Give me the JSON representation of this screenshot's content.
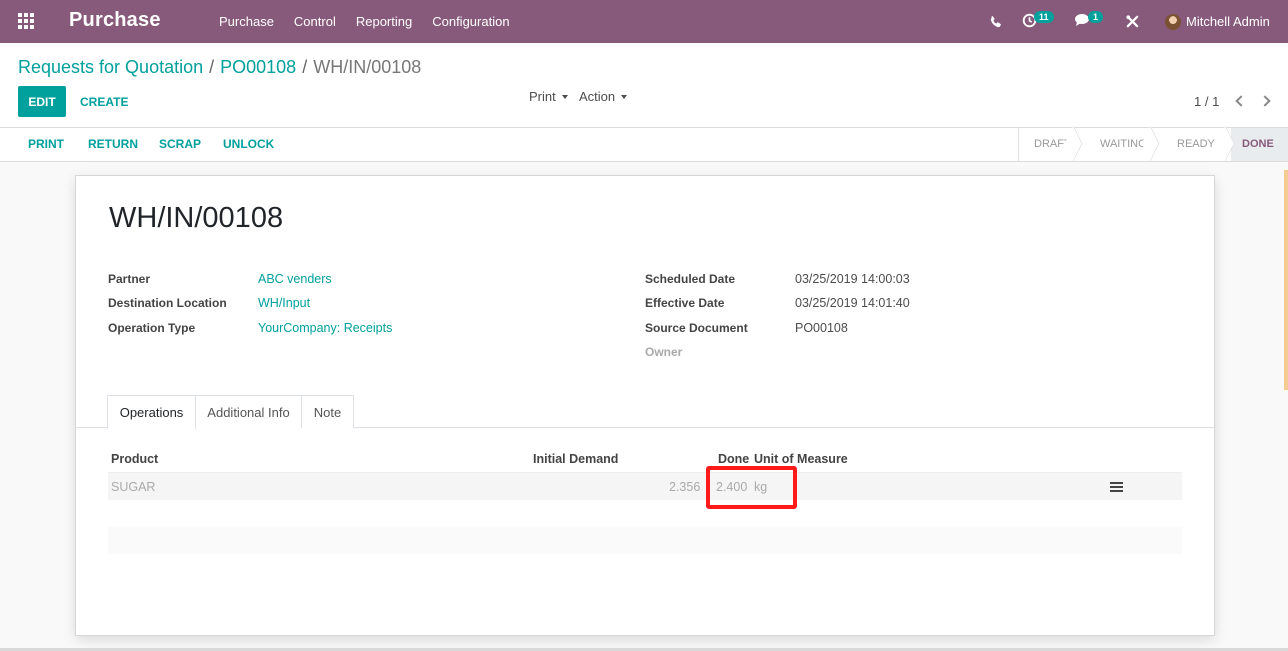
{
  "navbar": {
    "brand": "Purchase",
    "menu": [
      "Purchase",
      "Control",
      "Reporting",
      "Configuration"
    ],
    "activity_badge": "11",
    "messages_badge": "1",
    "user_name": "Mitchell Admin"
  },
  "breadcrumb": {
    "items": [
      "Requests for Quotation",
      "PO00108"
    ],
    "current": "WH/IN/00108"
  },
  "control": {
    "edit_label": "EDIT",
    "create_label": "CREATE",
    "print_label": "Print",
    "action_label": "Action",
    "pager": "1 / 1"
  },
  "header": {
    "buttons": [
      "PRINT",
      "RETURN",
      "SCRAP",
      "UNLOCK"
    ],
    "states": [
      "DRAFT",
      "WAITING",
      "READY",
      "DONE"
    ],
    "current_state": "DONE"
  },
  "record": {
    "title": "WH/IN/00108",
    "left_fields": [
      {
        "label": "Partner",
        "value": "ABC venders"
      },
      {
        "label": "Destination Location",
        "value": "WH/Input"
      },
      {
        "label": "Operation Type",
        "value": "YourCompany: Receipts"
      }
    ],
    "right_fields": [
      {
        "label": "Scheduled Date",
        "value": "03/25/2019 14:00:03"
      },
      {
        "label": "Effective Date",
        "value": "03/25/2019 14:01:40"
      },
      {
        "label": "Source Document",
        "value": "PO00108"
      },
      {
        "label": "Owner",
        "value": ""
      }
    ]
  },
  "tabs": [
    "Operations",
    "Additional Info",
    "Note"
  ],
  "operations": {
    "columns": [
      "Product",
      "Initial Demand",
      "Done",
      "Unit of Measure"
    ],
    "rows": [
      {
        "product": "SUGAR",
        "initial_demand": "2.356",
        "done": "2.400",
        "uom": "kg"
      }
    ]
  },
  "colors": {
    "brand": "#875a7b",
    "accent": "#00a09d",
    "highlight": "#ff1a1a"
  }
}
